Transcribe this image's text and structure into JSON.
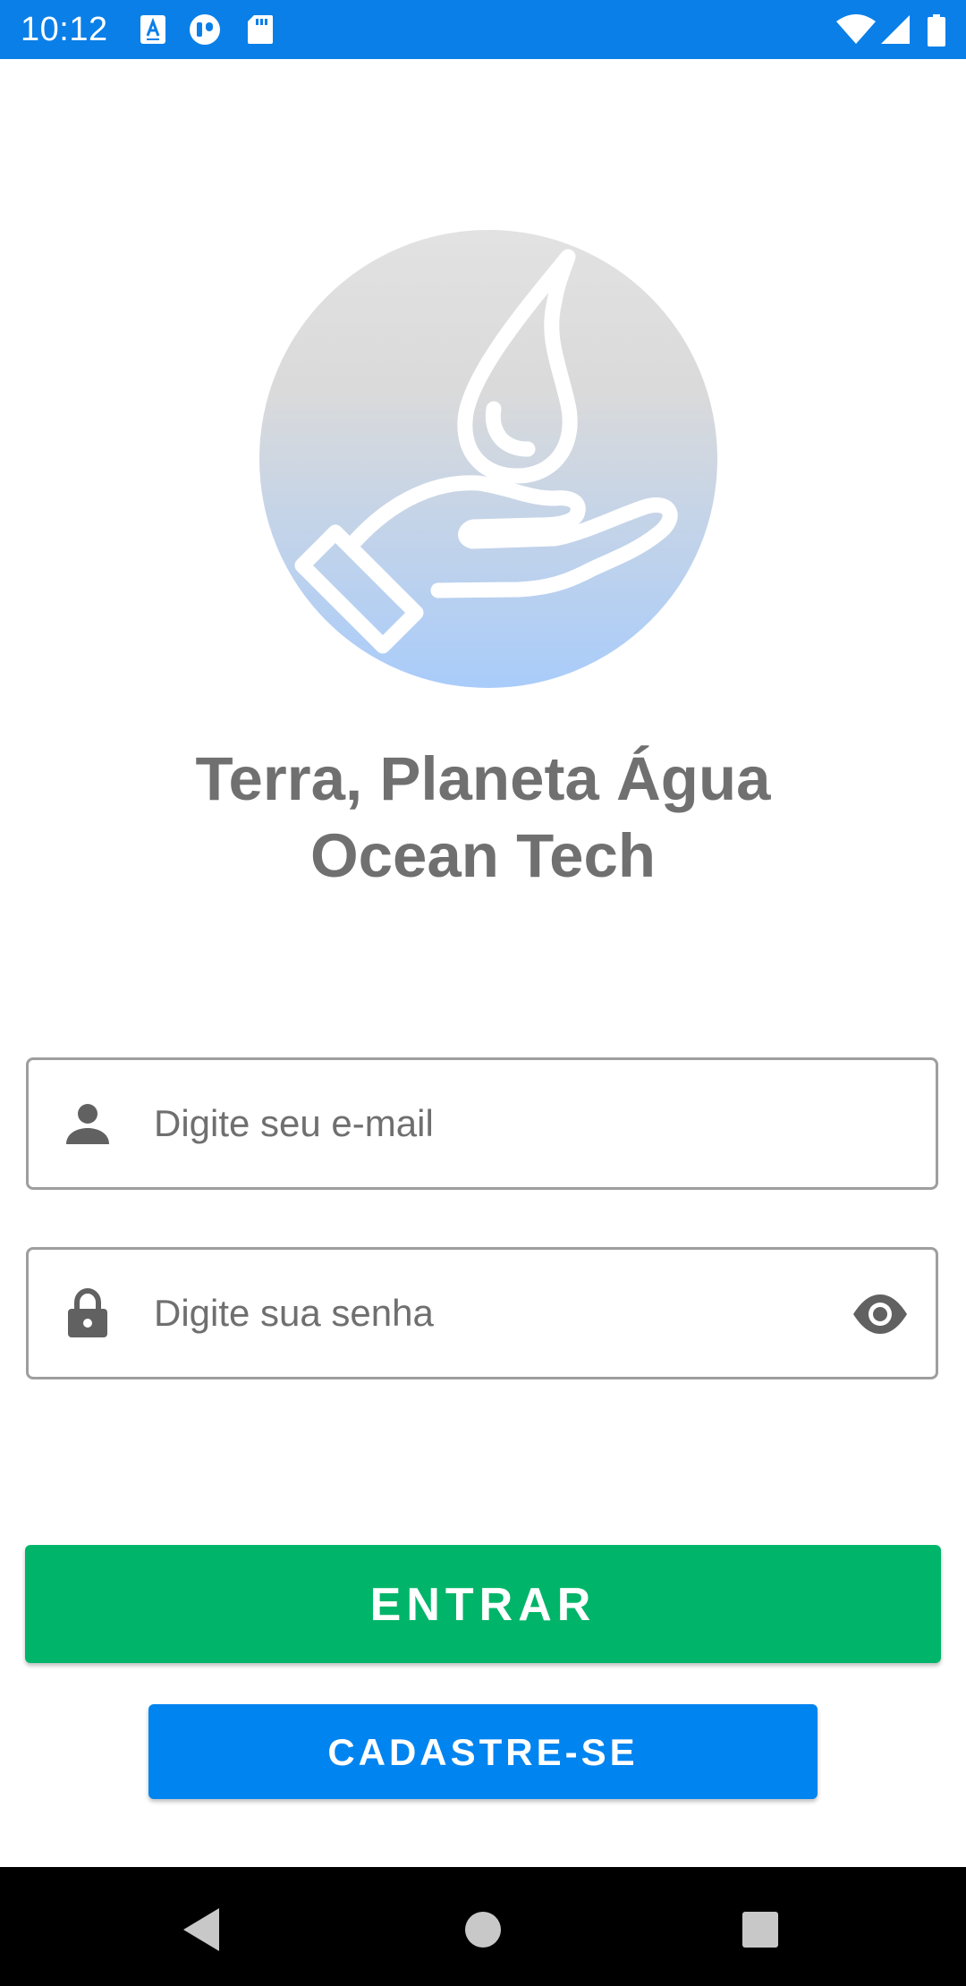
{
  "status_bar": {
    "time": "10:12",
    "notification_icons": [
      "a-box-icon",
      "headset-icon",
      "sd-card-icon"
    ],
    "system_icons": [
      "wifi-icon",
      "signal-icon",
      "battery-icon"
    ],
    "background_color": "#0a7fe8"
  },
  "logo": {
    "icon": "water-drop-hand-icon",
    "gradient_top": "#e2e2e2",
    "gradient_bottom": "#a9ccfa"
  },
  "title": {
    "line1": "Terra, Planeta Água",
    "line2": "Ocean Tech",
    "color": "#707070"
  },
  "form": {
    "email": {
      "placeholder": "Digite seu e-mail",
      "value": "",
      "icon": "person-icon"
    },
    "password": {
      "placeholder": "Digite sua senha",
      "value": "",
      "icon": "lock-icon",
      "toggle_icon": "eye-icon"
    }
  },
  "buttons": {
    "login_label": "ENTRAR",
    "login_color": "#00b569",
    "signup_label": "CADASTRE-SE",
    "signup_color": "#0084f0"
  },
  "nav_bar": {
    "buttons": [
      "back-icon",
      "home-icon",
      "recents-icon"
    ]
  }
}
